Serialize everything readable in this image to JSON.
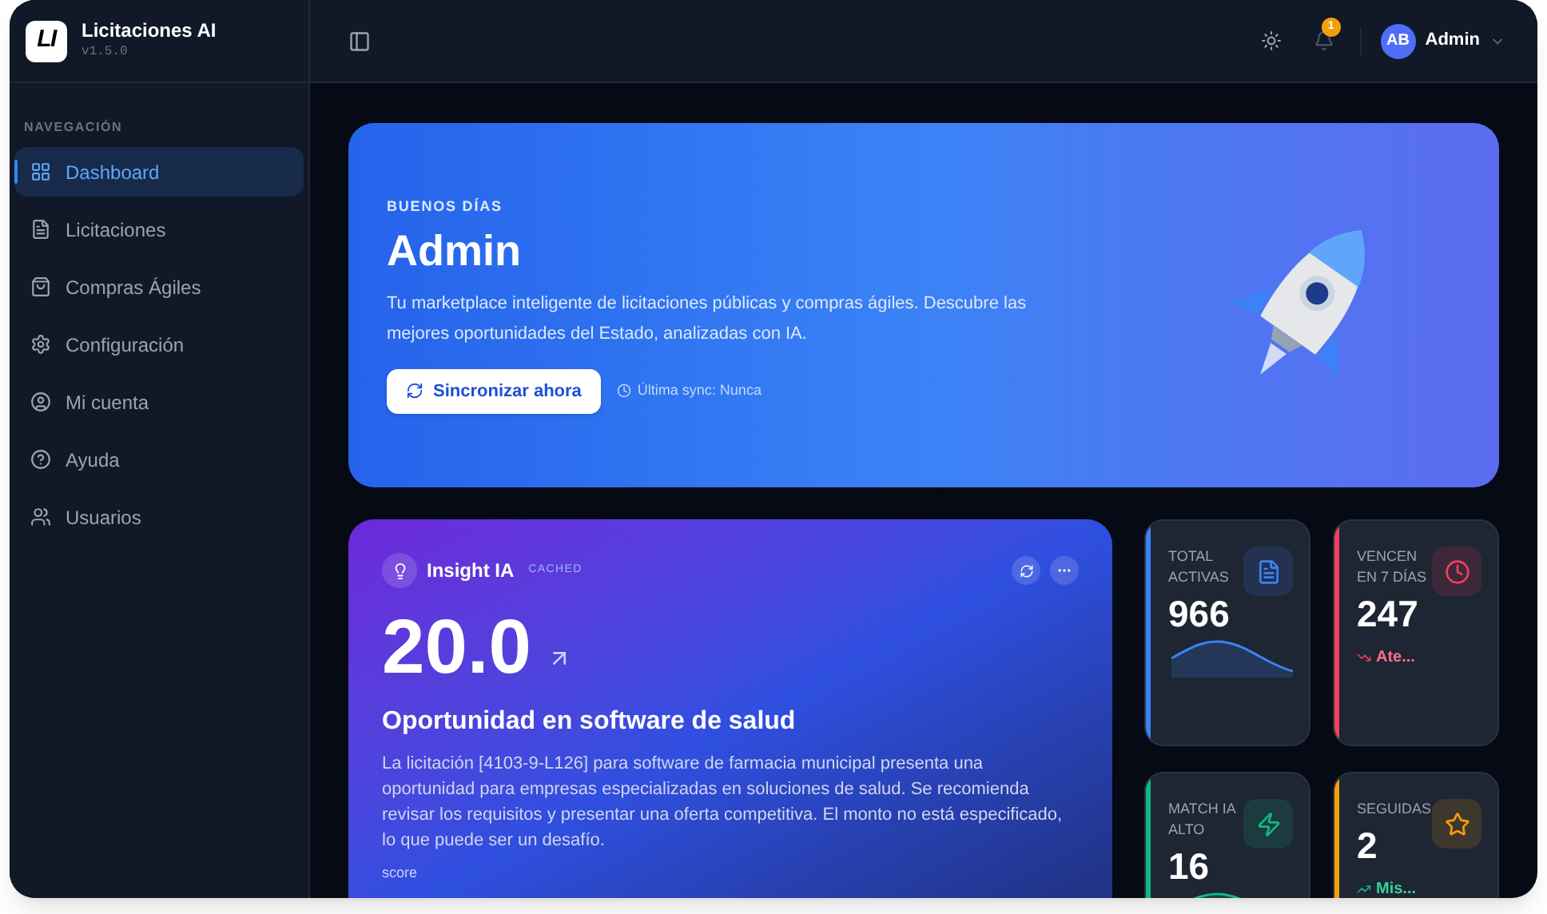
{
  "brand": {
    "logo_mark": "LI",
    "name": "Licitaciones AI",
    "version": "v1.5.0"
  },
  "sidebar": {
    "section": "NAVEGACIÓN",
    "items": [
      {
        "label": "Dashboard",
        "selected": true
      },
      {
        "label": "Licitaciones",
        "selected": false
      },
      {
        "label": "Compras Ágiles",
        "selected": false
      },
      {
        "label": "Configuración",
        "selected": false
      },
      {
        "label": "Mi cuenta",
        "selected": false
      },
      {
        "label": "Ayuda",
        "selected": false
      },
      {
        "label": "Usuarios",
        "selected": false
      }
    ]
  },
  "header": {
    "notifications": "1",
    "avatar": "AB",
    "user": "Admin"
  },
  "hero": {
    "greeting": "BUENOS DÍAS",
    "name": "Admin",
    "description": "Tu marketplace inteligente de licitaciones públicas y compras ágiles. Descubre las mejores oportunidades del Estado, analizadas con IA.",
    "button": "Sincronizar ahora",
    "last_sync": "Última sync: Nunca"
  },
  "insight": {
    "title": "Insight IA",
    "badge": "CACHED",
    "score": "20.0",
    "heading": "Oportunidad en software de salud",
    "body": "La licitación [4103-9-L126] para software de farmacia municipal presenta una oportunidad para empresas especializadas en soluciones de salud. Se recomienda revisar los requisitos y presentar una oferta competitiva. El monto no está especificado, lo que puede ser un desafío.",
    "label": "score"
  },
  "stats": [
    {
      "kind": "sparkline",
      "label": "TOTAL ACTIVAS",
      "value": "966",
      "color": "#3b82f6"
    },
    {
      "kind": "trend",
      "label": "VENCEN EN 7 DÍAS",
      "value": "247",
      "color": "#f43f5e",
      "trend": "Ate..."
    },
    {
      "kind": "sparkline",
      "label": "MATCH IA ALTO",
      "value": "16",
      "color": "#10b981"
    },
    {
      "kind": "trend",
      "label": "SEGUIDAS",
      "value": "2",
      "color": "#f59e0b",
      "trend": "Mis..."
    }
  ]
}
